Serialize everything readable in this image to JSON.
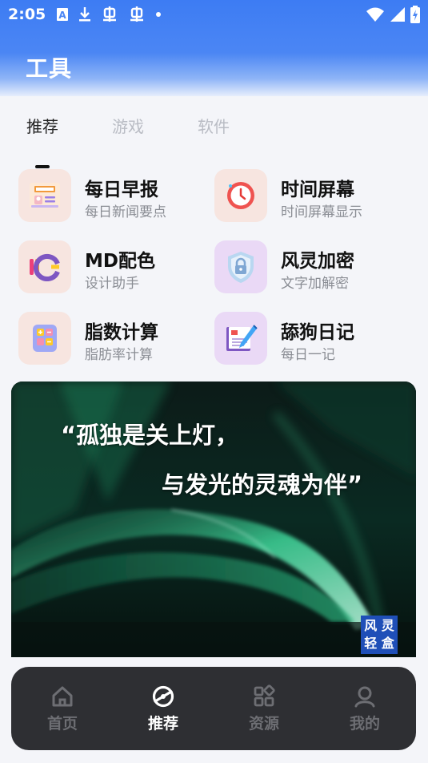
{
  "status_bar": {
    "time": "2:05",
    "left_icons": [
      "font-a-icon",
      "download-icon",
      "bug-icon",
      "bug-icon",
      "dot-icon"
    ],
    "right_icons": [
      "wifi-icon",
      "signal-icon",
      "battery-charging-icon"
    ]
  },
  "header": {
    "title": "工具",
    "gradient_top": "#3d7cf3"
  },
  "tabs": [
    {
      "label": "推荐",
      "active": true
    },
    {
      "label": "游戏",
      "active": false
    },
    {
      "label": "软件",
      "active": false
    }
  ],
  "tools": [
    {
      "name": "每日早报",
      "desc": "每日新闻要点",
      "icon": "newspaper-icon",
      "bg": "#f7e5e0"
    },
    {
      "name": "时间屏幕",
      "desc": "时间屏幕显示",
      "icon": "clock-icon",
      "bg": "#f7e5e0"
    },
    {
      "name": "MD配色",
      "desc": "设计助手",
      "icon": "palette-icon",
      "bg": "#f7e5e0"
    },
    {
      "name": "风灵加密",
      "desc": "文字加解密",
      "icon": "shield-lock-icon",
      "bg": "#ead9f6"
    },
    {
      "name": "脂数计算",
      "desc": "脂肪率计算",
      "icon": "calculator-icon",
      "bg": "#f7e5e0"
    },
    {
      "name": "舔狗日记",
      "desc": "每日一记",
      "icon": "diary-icon",
      "bg": "#ead9f6"
    }
  ],
  "banner": {
    "quote_line1": "“孤独是关上灯，",
    "quote_line2": "与发光的灵魂为伴”",
    "badge_line1": "风 灵",
    "badge_line2": "轻 盒"
  },
  "bottom_nav": [
    {
      "label": "首页",
      "icon": "home-icon",
      "active": false
    },
    {
      "label": "推荐",
      "icon": "compass-icon",
      "active": true
    },
    {
      "label": "资源",
      "icon": "grid-icon",
      "active": false
    },
    {
      "label": "我的",
      "icon": "user-icon",
      "active": false
    }
  ],
  "colors": {
    "accent": "#3d7cf3",
    "nav_bg": "#2e2f33",
    "page_bg": "#f4f5f9"
  }
}
